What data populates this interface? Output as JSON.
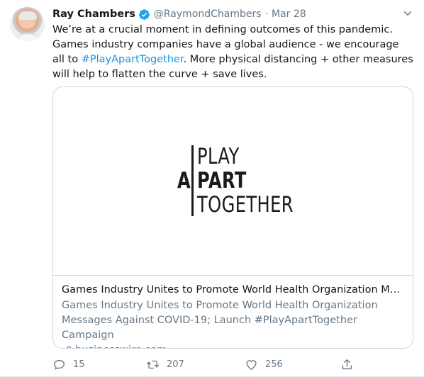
{
  "tweet": {
    "author": {
      "name": "Ray Chambers",
      "handle": "@RaymondChambers",
      "verified": true
    },
    "separator": "·",
    "date": "Mar 28",
    "text": {
      "part1": "We’re at a crucial moment in defining outcomes of this pandemic. Games industry companies have a global audience - we encourage all to ",
      "hashtag": "#PlayApartTogether",
      "part2": ". More physical distancing + other measures will help to flatten the curve + save lives."
    },
    "card": {
      "logo": {
        "line1": "PLAY",
        "line2_prefix": "A",
        "line2": "PART",
        "line3": "TOGETHER"
      },
      "title": "Games Industry Unites to Promote World Health Organization Messa…",
      "description": "Games Industry Unites to Promote World Health Organization Messages Against COVID-19; Launch #PlayApartTogether Campaign",
      "domain": "businesswire.com"
    },
    "actions": {
      "replies": "15",
      "retweets": "207",
      "likes": "256"
    }
  },
  "colors": {
    "link": "#1b95e0",
    "secondary_text": "#657786",
    "verified_badge": "#1da1f2",
    "border": "#ccd6dd"
  },
  "icons": [
    "verified-badge-icon",
    "chevron-down-icon",
    "link-icon",
    "reply-icon",
    "retweet-icon",
    "like-icon",
    "share-icon"
  ]
}
